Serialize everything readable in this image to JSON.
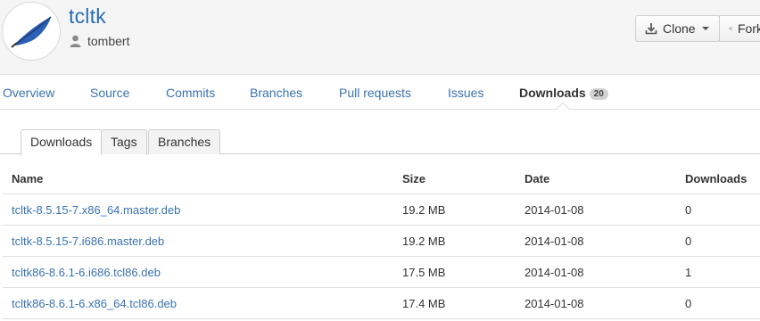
{
  "repo": {
    "name": "tcltk",
    "owner": "tombert",
    "clone_label": "Clone",
    "fork_label": "Fork"
  },
  "nav": {
    "tabs": [
      {
        "label": "Overview"
      },
      {
        "label": "Source"
      },
      {
        "label": "Commits"
      },
      {
        "label": "Branches"
      },
      {
        "label": "Pull requests"
      },
      {
        "label": "Issues"
      },
      {
        "label": "Downloads",
        "count": "20",
        "active": true
      }
    ]
  },
  "subtabs": [
    {
      "label": "Downloads",
      "active": true
    },
    {
      "label": "Tags"
    },
    {
      "label": "Branches"
    }
  ],
  "table": {
    "headers": {
      "name": "Name",
      "size": "Size",
      "date": "Date",
      "downloads": "Downloads"
    },
    "rows": [
      {
        "name": "tcltk-8.5.15-7.x86_64.master.deb",
        "size": "19.2 MB",
        "date": "2014-01-08",
        "downloads": "0"
      },
      {
        "name": "tcltk-8.5.15-7.i686.master.deb",
        "size": "19.2 MB",
        "date": "2014-01-08",
        "downloads": "0"
      },
      {
        "name": "tcltk86-8.6.1-6.i686.tcl86.deb",
        "size": "17.5 MB",
        "date": "2014-01-08",
        "downloads": "1"
      },
      {
        "name": "tcltk86-8.6.1-6.x86_64.tcl86.deb",
        "size": "17.4 MB",
        "date": "2014-01-08",
        "downloads": "0"
      }
    ]
  },
  "icons": {
    "avatar": "feather-avatar-icon",
    "owner": "user-icon",
    "clone": "download-icon",
    "fork": "fork-icon"
  },
  "colors": {
    "link": "#3a73b0",
    "title": "#2a6db0",
    "header_bg": "#f5f5f5"
  }
}
